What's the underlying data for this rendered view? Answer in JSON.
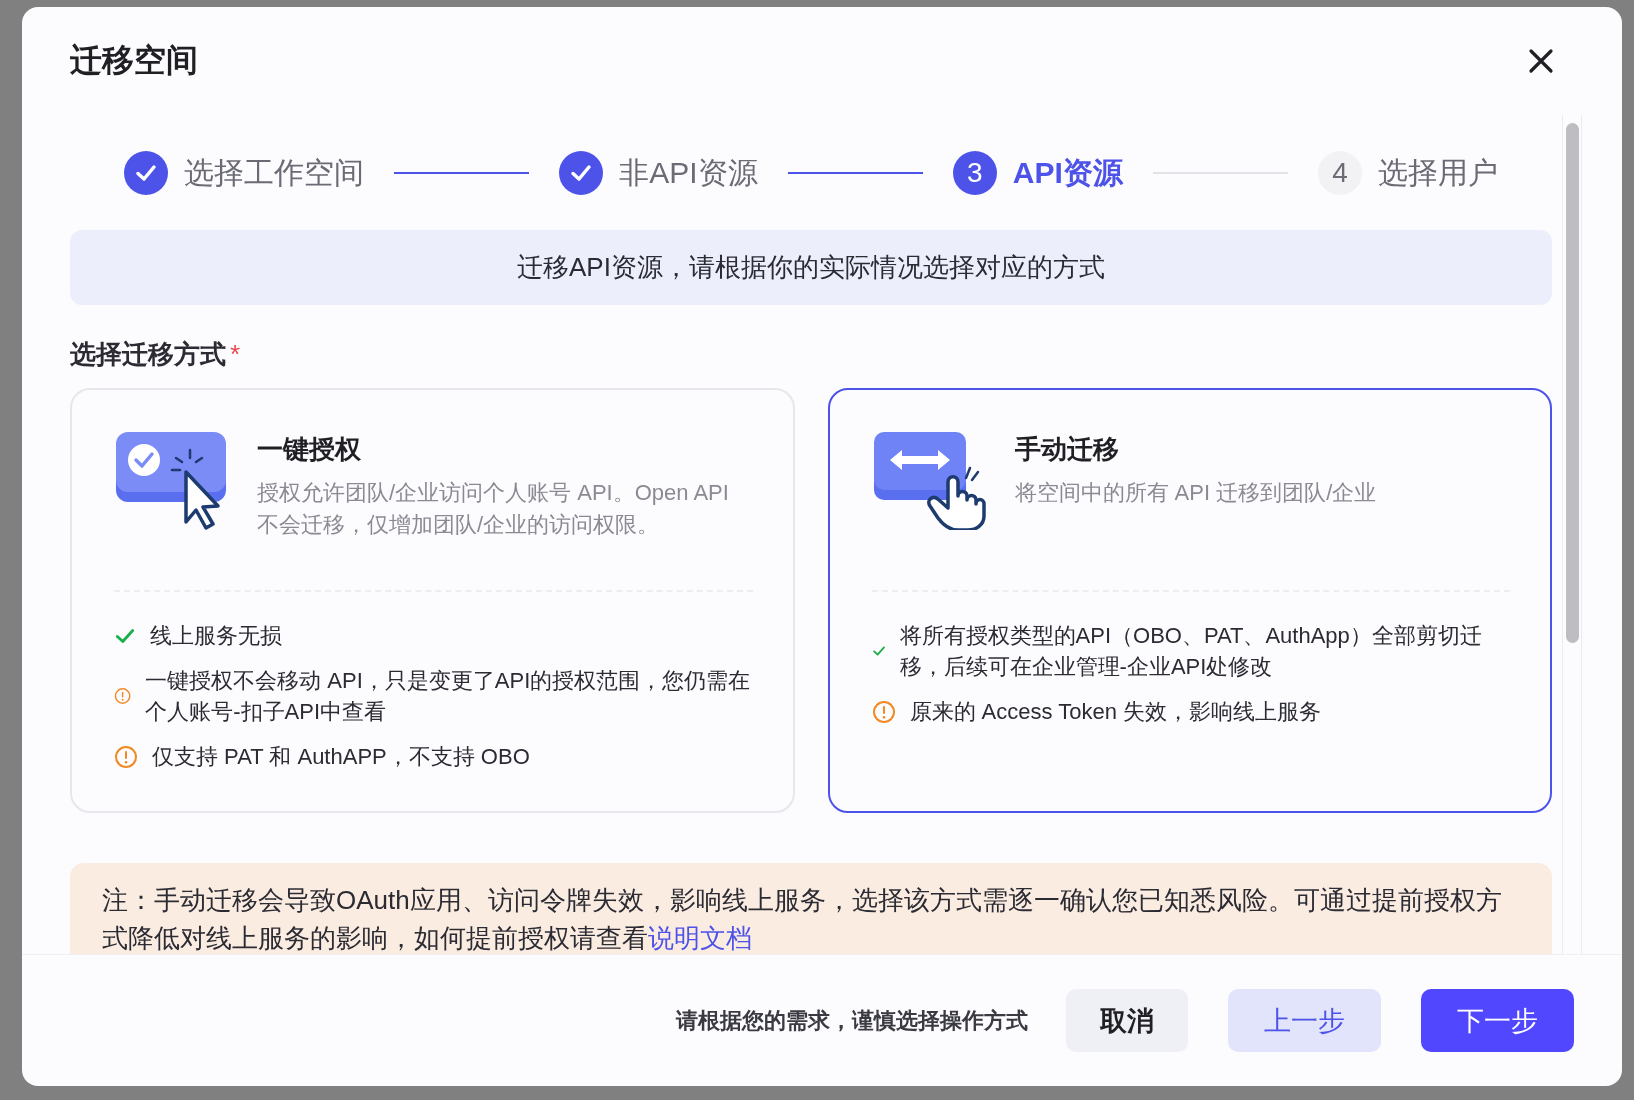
{
  "dialog": {
    "title": "迁移空间"
  },
  "steps": [
    {
      "label": "选择工作空间",
      "completed": true,
      "selected": false
    },
    {
      "label": "非API资源",
      "completed": true,
      "selected": false
    },
    {
      "label": "API资源",
      "completed": false,
      "selected": true,
      "number": "3"
    },
    {
      "label": "选择用户",
      "completed": false,
      "selected": false,
      "number": "4"
    }
  ],
  "banner": "迁移API资源，请根据你的实际情况选择对应的方式",
  "method_label": "选择迁移方式",
  "required_mark": "*",
  "options": [
    {
      "title": "一键授权",
      "description": "授权允许团队/企业访问个人账号 API。Open API 不会迁移，仅增加团队/企业的访问权限。",
      "selected": false,
      "notes": [
        {
          "kind": "check",
          "text": "线上服务无损"
        },
        {
          "kind": "warning",
          "text": "一键授权不会移动 API，只是变更了API的授权范围，您仍需在个人账号-扣子API中查看"
        },
        {
          "kind": "warning",
          "text": "仅支持 PAT 和 AuthAPP，不支持 OBO"
        }
      ]
    },
    {
      "title": "手动迁移",
      "description": "将空间中的所有 API 迁移到团队/企业",
      "selected": true,
      "notes": [
        {
          "kind": "check",
          "text": "将所有授权类型的API（OBO、PAT、AuthApp）全部剪切迁移，后续可在企业管理-企业API处修改"
        },
        {
          "kind": "warning",
          "text": "原来的 Access Token 失效，影响线上服务"
        }
      ]
    }
  ],
  "notice": {
    "text": "注：手动迁移会导致OAuth应用、访问令牌失效，影响线上服务，选择该方式需逐一确认您已知悉风险。可通过提前授权方式降低对线上服务的影响，如何提前授权请查看",
    "link": "说明文档"
  },
  "footer": {
    "hint": "请根据您的需求，谨慎选择操作方式",
    "buttons": [
      {
        "label": "取消",
        "kind": "secondary"
      },
      {
        "label": "上一步",
        "kind": "light"
      },
      {
        "label": "下一步",
        "kind": "primary"
      }
    ]
  }
}
